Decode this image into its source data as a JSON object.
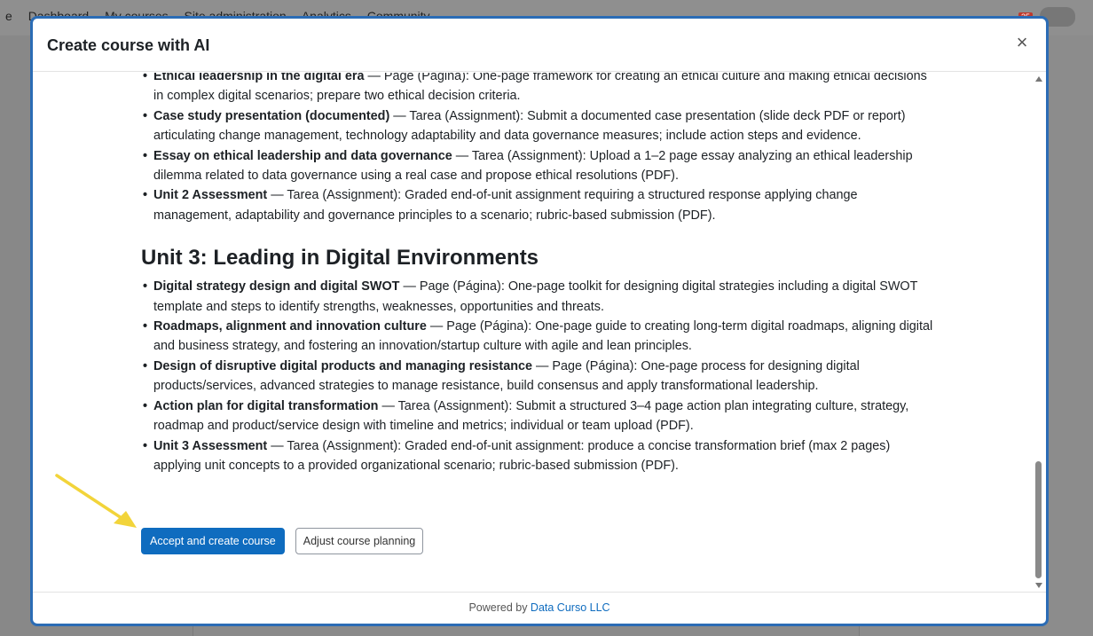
{
  "background": {
    "nav_items": [
      "e",
      "Dashboard",
      "My courses",
      "Site administration",
      "Analytics",
      "Community"
    ],
    "notification_count": "35"
  },
  "modal": {
    "title": "Create course with AI",
    "close_label": "×"
  },
  "sections": [
    {
      "heading": "",
      "items": [
        {
          "title": "Ethical leadership in the digital era",
          "text": " — Page (Página): One-page framework for creating an ethical culture and making ethical decisions in complex digital scenarios; prepare two ethical decision criteria."
        },
        {
          "title": "Case study presentation (documented)",
          "text": " — Tarea (Assignment): Submit a documented case presentation (slide deck PDF or report) articulating change management, technology adaptability and data governance measures; include action steps and evidence."
        },
        {
          "title": "Essay on ethical leadership and data governance",
          "text": " — Tarea (Assignment): Upload a 1–2 page essay analyzing an ethical leadership dilemma related to data governance using a real case and propose ethical resolutions (PDF)."
        },
        {
          "title": "Unit 2 Assessment",
          "text": " — Tarea (Assignment): Graded end-of-unit assignment requiring a structured response applying change management, adaptability and governance principles to a scenario; rubric-based submission (PDF)."
        }
      ]
    },
    {
      "heading": "Unit 3: Leading in Digital Environments",
      "items": [
        {
          "title": "Digital strategy design and digital SWOT",
          "text": " — Page (Página): One-page toolkit for designing digital strategies including a digital SWOT template and steps to identify strengths, weaknesses, opportunities and threats."
        },
        {
          "title": "Roadmaps, alignment and innovation culture",
          "text": " — Page (Página): One-page guide to creating long-term digital roadmaps, aligning digital and business strategy, and fostering an innovation/startup culture with agile and lean principles."
        },
        {
          "title": "Design of disruptive digital products and managing resistance",
          "text": " — Page (Página): One-page process for designing digital products/services, advanced strategies to manage resistance, build consensus and apply transformational leadership."
        },
        {
          "title": "Action plan for digital transformation",
          "text": " — Tarea (Assignment): Submit a structured 3–4 page action plan integrating culture, strategy, roadmap and product/service design with timeline and metrics; individual or team upload (PDF)."
        },
        {
          "title": "Unit 3 Assessment",
          "text": " — Tarea (Assignment): Graded end-of-unit assignment: produce a concise transformation brief (max 2 pages) applying unit concepts to a provided organizational scenario; rubric-based submission (PDF)."
        }
      ]
    }
  ],
  "actions": {
    "accept_label": "Accept and create course",
    "adjust_label": "Adjust course planning"
  },
  "footer": {
    "prefix": "Powered by ",
    "link_text": "Data Curso LLC"
  },
  "colors": {
    "primary": "#0f6cbf",
    "modal_border": "#2b6cb5",
    "arrow": "#f2d43a"
  }
}
